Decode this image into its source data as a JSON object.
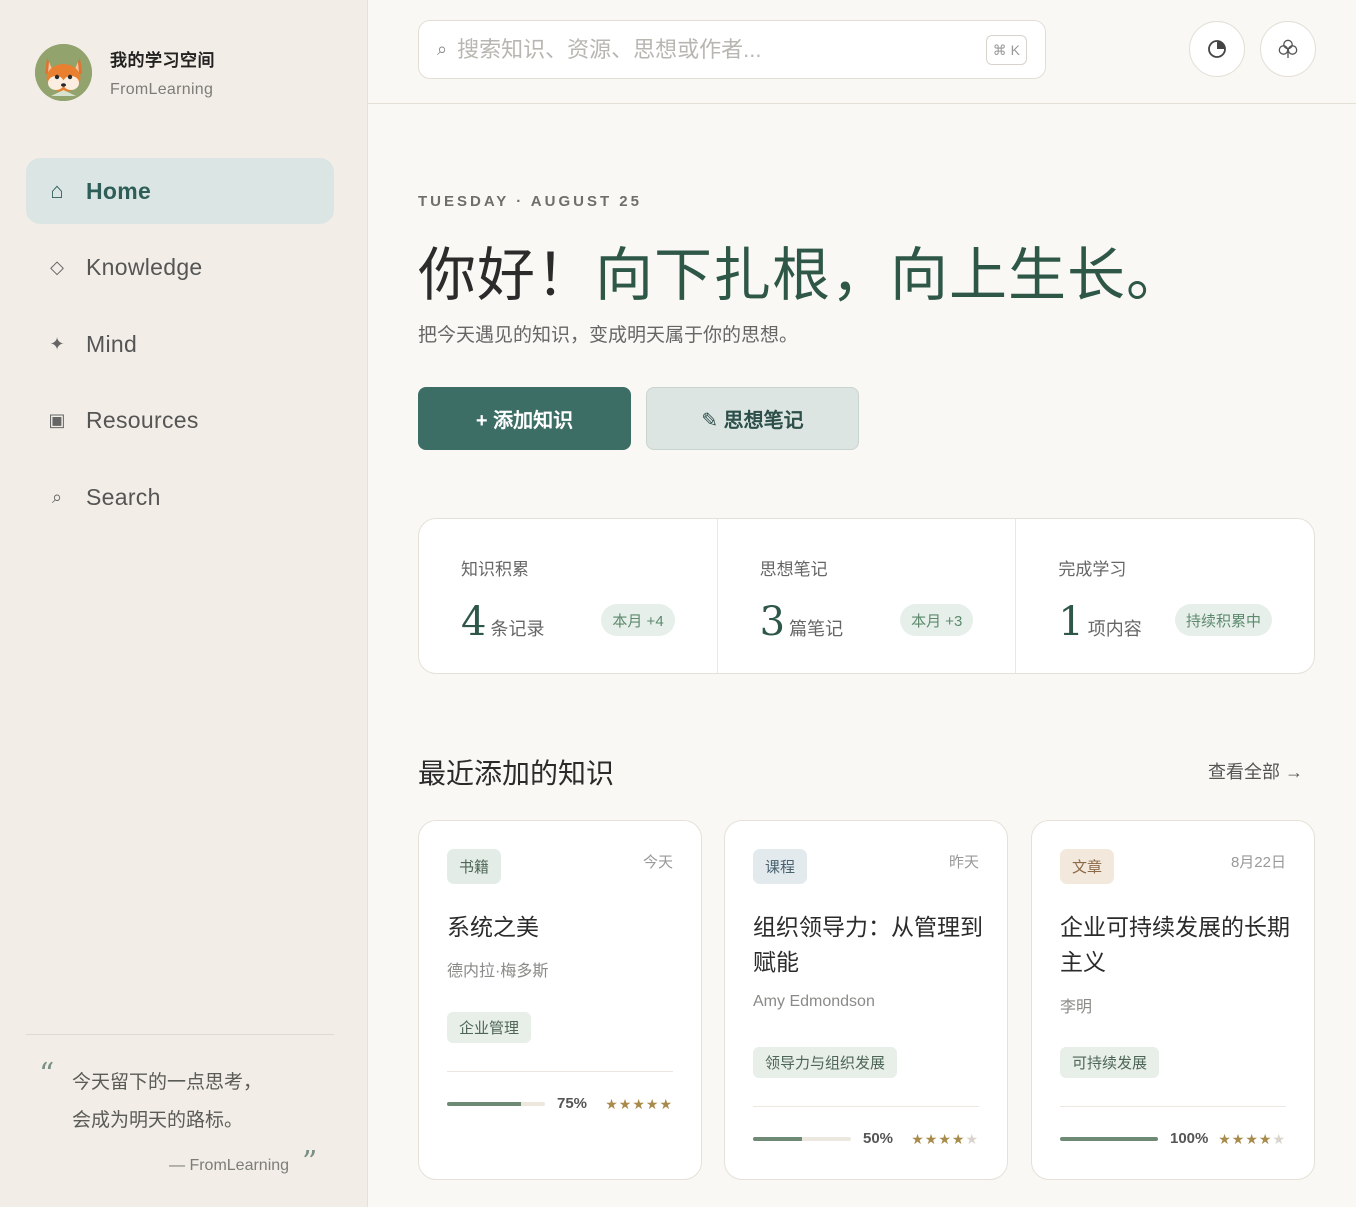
{
  "sidebar": {
    "brand_title": "我的学习空间",
    "brand_sub": "FromLearning",
    "nav": [
      {
        "label": "Home",
        "icon": "home-icon",
        "glyph": "⌂",
        "active": true
      },
      {
        "label": "Knowledge",
        "icon": "diamond-icon",
        "glyph": "◇",
        "active": false
      },
      {
        "label": "Mind",
        "icon": "sparkle-icon",
        "glyph": "✦",
        "active": false
      },
      {
        "label": "Resources",
        "icon": "square-icon",
        "glyph": "▣",
        "active": false
      },
      {
        "label": "Search",
        "icon": "search-icon",
        "glyph": "⌕",
        "active": false
      }
    ],
    "quote": {
      "line1": "今天留下的一点思考，",
      "line2": "会成为明天的路标。",
      "author": "— FromLearning"
    }
  },
  "topbar": {
    "search_placeholder": "搜索知识、资源、思想或作者...",
    "shortcut": "⌘ K"
  },
  "main": {
    "date": "TUESDAY · AUGUST 25",
    "headline_a": "你好！",
    "headline_b": "向下扎根，向上生长。",
    "subline": "把今天遇见的知识，变成明天属于你的思想。",
    "add_button": "+ 添加知识",
    "note_button": "✎ 思想笔记",
    "stats": [
      {
        "title": "知识积累",
        "num": "4",
        "unit": "条记录",
        "badge": "本月 +4"
      },
      {
        "title": "思想笔记",
        "num": "3",
        "unit": "篇笔记",
        "badge": "本月 +3"
      },
      {
        "title": "完成学习",
        "num": "1",
        "unit": "项内容",
        "badge": "持续积累中"
      }
    ],
    "section_title": "最近添加的知识",
    "view_all": "查看全部 →",
    "cards": [
      {
        "tag": "书籍",
        "tag_color": "#e3ece6",
        "tag_text": "#4d6656",
        "date": "今天",
        "title": "系统之美",
        "author": "德内拉·梅多斯",
        "topic": "企业管理",
        "progress": 0.75,
        "progress_label": "75%",
        "rating": 5
      },
      {
        "tag": "课程",
        "tag_color": "#e2eaee",
        "tag_text": "#4a6270",
        "date": "昨天",
        "title": "组织领导力：从管理到赋能",
        "author": "Amy Edmondson",
        "topic": "领导力与组织发展",
        "progress": 0.5,
        "progress_label": "50%",
        "rating": 4
      },
      {
        "tag": "文章",
        "tag_color": "#f3e8dc",
        "tag_text": "#8a6a48",
        "date": "8月22日",
        "title": "企业可持续发展的长期主义",
        "author": "李明",
        "topic": "可持续发展",
        "progress": 1.0,
        "progress_label": "100%",
        "rating": 4
      }
    ]
  }
}
